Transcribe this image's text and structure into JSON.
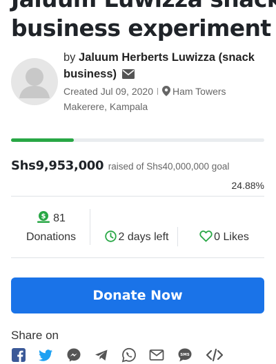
{
  "campaign": {
    "title_line1": "Jaluum Luwizza snack",
    "title_line2": "business experiment"
  },
  "organizer": {
    "by_prefix": "by",
    "name": "Jaluum Herberts Luwizza (snack business)",
    "created": "Created Jul 09, 2020",
    "location": "Ham Towers Makerere, Kampala"
  },
  "funding": {
    "raised": "Shs9,953,000",
    "goal_text": "raised of Shs40,000,000 goal",
    "percent_text": "24.88%",
    "progress_fraction": 0.2488
  },
  "stats": {
    "donations_count": "81",
    "donations_label": "Donations",
    "days_left": "2 days left",
    "likes": "0 Likes"
  },
  "actions": {
    "donate_label": "Donate Now"
  },
  "share": {
    "label": "Share on",
    "icons": [
      "facebook-icon",
      "twitter-icon",
      "messenger-icon",
      "telegram-icon",
      "whatsapp-icon",
      "email-icon",
      "sms-icon",
      "embed-icon"
    ]
  },
  "colors": {
    "accent_green": "#28a745",
    "brand_blue": "#1a73e8",
    "facebook": "#3b5998",
    "twitter": "#1da1f2",
    "muted_text": "#666666"
  }
}
